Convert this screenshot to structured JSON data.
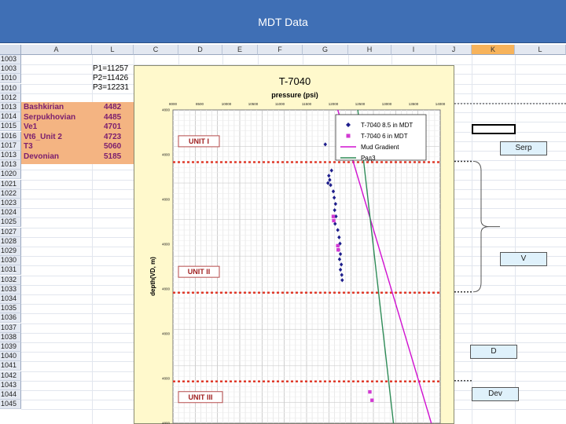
{
  "window": {
    "title": "MDT Data"
  },
  "columns": [
    "A",
    "L",
    "C",
    "D",
    "E",
    "F",
    "G",
    "H",
    "I",
    "J",
    "K",
    "L"
  ],
  "selected_column": "K",
  "rows": [
    "1003",
    "1003",
    "1010",
    "1010",
    "1012",
    "1013",
    "1014",
    "1015",
    "1016",
    "1017",
    "1013",
    "1013",
    "1020",
    "1021",
    "1022",
    "1023",
    "1024",
    "1025",
    "1027",
    "1028",
    "1029",
    "1030",
    "1031",
    "1032",
    "1033",
    "1034",
    "1035",
    "1036",
    "1037",
    "1038",
    "1039",
    "1040",
    "1041",
    "1042",
    "1043",
    "1044",
    "1045"
  ],
  "pressures": [
    "P1=11257",
    "P2=11426",
    "P3=12231"
  ],
  "strata": [
    {
      "name": "Bashkirian",
      "depth": "4482"
    },
    {
      "name": "Serpukhovian",
      "depth": "4485"
    },
    {
      "name": "Ve1",
      "depth": "4701"
    },
    {
      "name": "Vt6_Unit 2",
      "depth": "4723"
    },
    {
      "name": "T3",
      "depth": "5060"
    },
    {
      "name": "Devonian",
      "depth": "5185"
    }
  ],
  "side_labels": {
    "serp": "Serp",
    "v": "V",
    "d": "D",
    "dev": "Dev"
  },
  "colors": {
    "mdt85": "#1e1e8c",
    "mdt6": "#d23ad2",
    "mud": "#d010d0",
    "row3": "#2e8b57",
    "dotline": "#e03a2a"
  },
  "chart_data": {
    "type": "scatter",
    "title": "T-7040",
    "xlabel": "pressure (psi)",
    "ylabel": "depth(VD, m)",
    "xlim": [
      8000,
      14000
    ],
    "ylim": [
      4800,
      5100
    ],
    "x_ticks": [
      "8000",
      "8500",
      "10000",
      "10500",
      "11000",
      "11500",
      "12000",
      "12500",
      "13000",
      "13500",
      "14000"
    ],
    "y_ticks": [
      "4800",
      "4800",
      "4800",
      "4800",
      "4800",
      "4800",
      "4800",
      "4800"
    ],
    "legend_position": "top-right",
    "units": [
      {
        "label": "UNIT I",
        "depth": 4830
      },
      {
        "label": "UNIT II",
        "depth": 4955
      },
      {
        "label": "UNIT III",
        "depth": 5075
      }
    ],
    "boundaries": [
      4850,
      4975,
      5060
    ],
    "series": [
      {
        "name": "T-7040 8.5 in MDT",
        "kind": "points",
        "points": [
          [
            11420,
            4833
          ],
          [
            11560,
            4858
          ],
          [
            11500,
            4863
          ],
          [
            11520,
            4867
          ],
          [
            11480,
            4870
          ],
          [
            11540,
            4872
          ],
          [
            11600,
            4878
          ],
          [
            11620,
            4884
          ],
          [
            11650,
            4890
          ],
          [
            11630,
            4896
          ],
          [
            11660,
            4902
          ],
          [
            11640,
            4909
          ],
          [
            11700,
            4915
          ],
          [
            11730,
            4922
          ],
          [
            11750,
            4928
          ],
          [
            11720,
            4934
          ],
          [
            11760,
            4938
          ],
          [
            11740,
            4943
          ],
          [
            11780,
            4948
          ],
          [
            11760,
            4953
          ],
          [
            11790,
            4958
          ],
          [
            11800,
            4963
          ]
        ]
      },
      {
        "name": "T-7040 6 in MDT",
        "kind": "points",
        "points": [
          [
            11600,
            4902
          ],
          [
            11610,
            4906
          ],
          [
            11700,
            4930
          ],
          [
            11710,
            4934
          ],
          [
            12420,
            5070
          ],
          [
            12470,
            5078
          ]
        ]
      },
      {
        "name": "Mud Gradient",
        "kind": "line",
        "points": [
          [
            11700,
            4800
          ],
          [
            13800,
            5100
          ]
        ]
      },
      {
        "name": "Ряд3",
        "kind": "line",
        "points": [
          [
            12150,
            4800
          ],
          [
            12950,
            5100
          ]
        ]
      }
    ]
  }
}
